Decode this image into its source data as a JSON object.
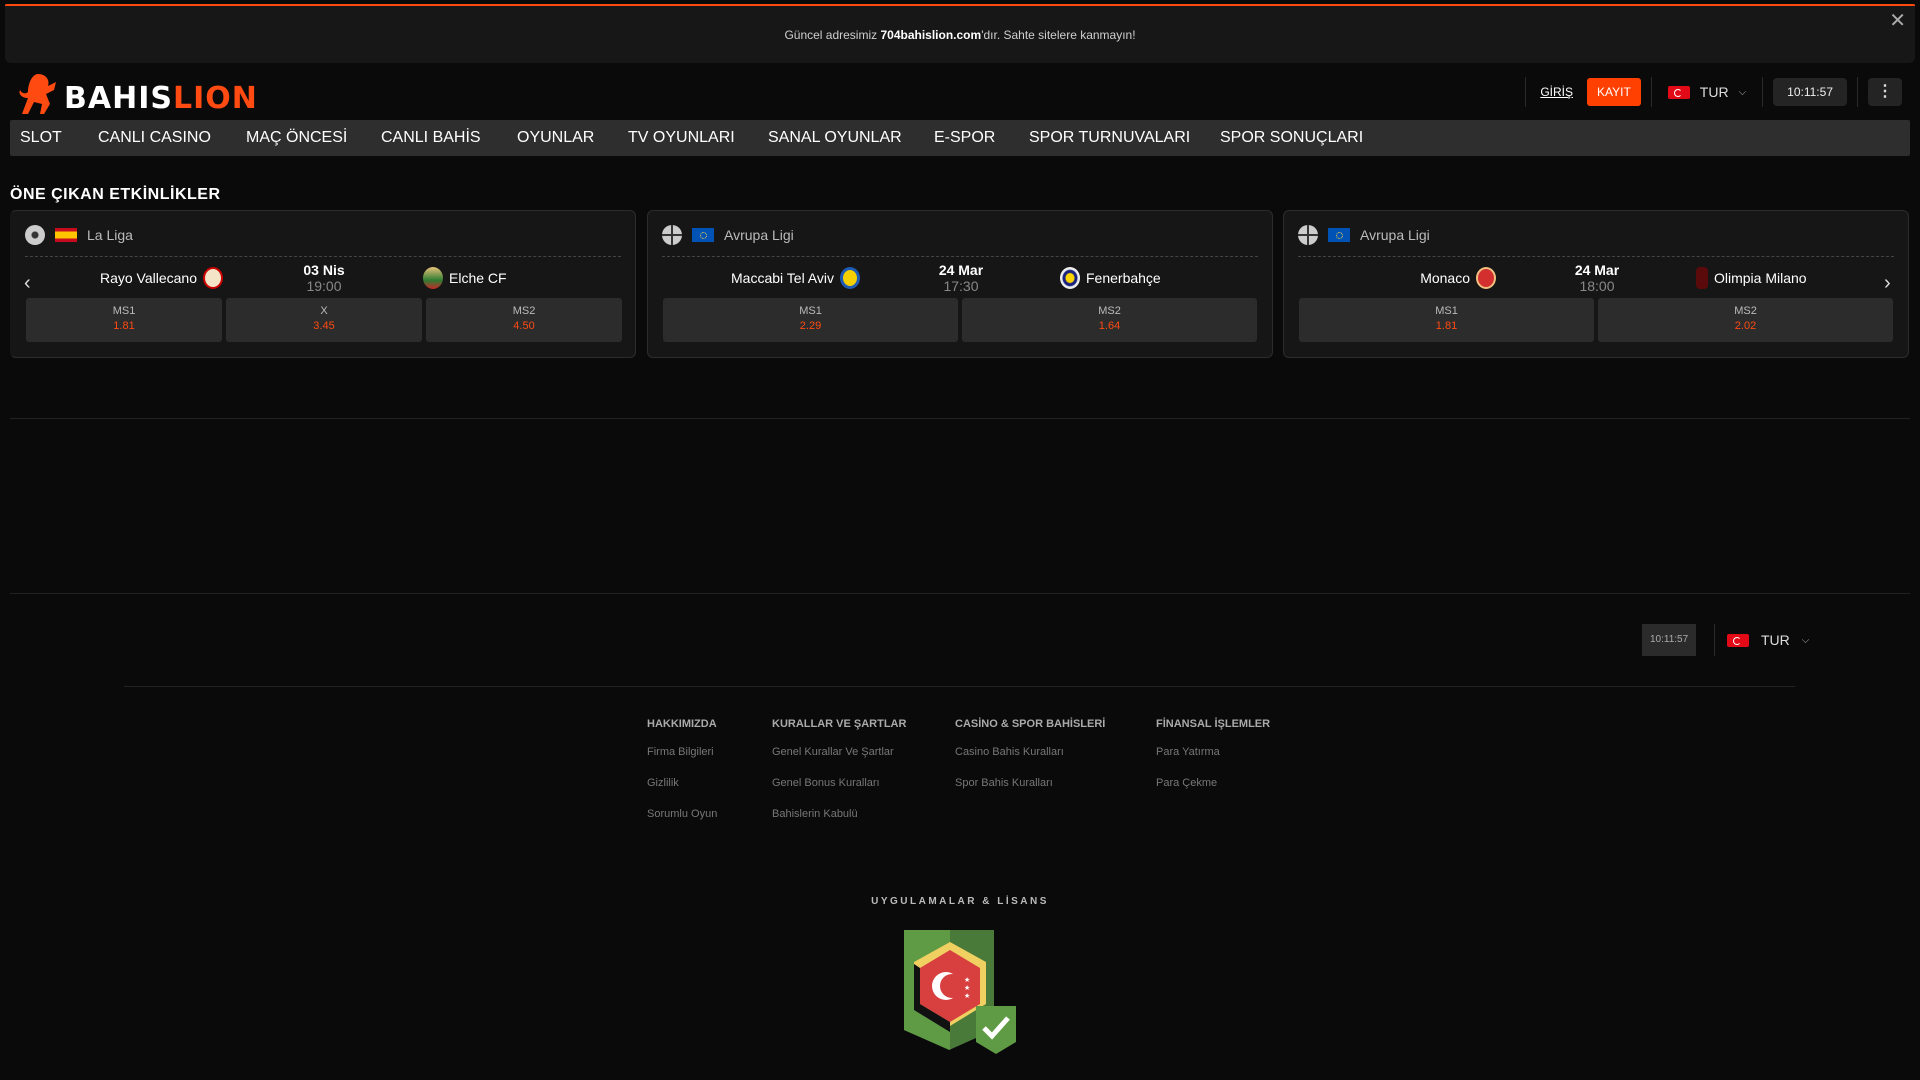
{
  "banner": {
    "prefix": "Güncel adresimiz ",
    "domain": "704bahislion.com",
    "suffix": "'dır. Sahte sitelere kanmayın!"
  },
  "logo": {
    "part1": "BAHIS",
    "part2": "LION"
  },
  "header": {
    "login": "GİRİŞ",
    "register": "KAYIT",
    "lang": "TUR",
    "clock": "10:11:57"
  },
  "nav": [
    "SLOT",
    "CANLI CASINO",
    "MAÇ ÖNCESİ",
    "CANLI BAHİS",
    "OYUNLAR",
    "TV OYUNLARI",
    "SANAL OYUNLAR",
    "E-SPOR",
    "SPOR TURNUVALARI",
    "SPOR SONUÇLARI"
  ],
  "featured": {
    "title": "ÖNE ÇIKAN ETKİNLİKLER",
    "events": [
      {
        "league": "La Liga",
        "home": "Rayo Vallecano",
        "away": "Elche CF",
        "date": "03 Nis",
        "time": "19:00",
        "odds": [
          {
            "label": "MS1",
            "value": "1.81"
          },
          {
            "label": "X",
            "value": "3.45"
          },
          {
            "label": "MS2",
            "value": "4.50"
          }
        ]
      },
      {
        "league": "Avrupa Ligi",
        "home": "Maccabi Tel Aviv",
        "away": "Fenerbahçe",
        "date": "24 Mar",
        "time": "17:30",
        "odds": [
          {
            "label": "MS1",
            "value": "2.29"
          },
          {
            "label": "MS2",
            "value": "1.64"
          }
        ]
      },
      {
        "league": "Avrupa Ligi",
        "home": "Monaco",
        "away": "Olimpia Milano",
        "date": "24 Mar",
        "time": "18:00",
        "odds": [
          {
            "label": "MS1",
            "value": "1.81"
          },
          {
            "label": "MS2",
            "value": "2.02"
          }
        ]
      }
    ]
  },
  "footer": {
    "clock": "10:11:57",
    "lang": "TUR",
    "columns": [
      {
        "title": "HAKKIMIZDA",
        "links": [
          "Firma Bilgileri",
          "Gizlilik",
          "Sorumlu Oyun"
        ]
      },
      {
        "title": "KURALLAR VE ŞARTLAR",
        "links": [
          "Genel Kurallar Ve Şartlar",
          "Genel Bonus Kuralları",
          "Bahislerin Kabulü"
        ]
      },
      {
        "title": "CASİNO & SPOR BAHİSLERİ",
        "links": [
          "Casino Bahis Kuralları",
          "Spor Bahis Kuralları"
        ]
      },
      {
        "title": "FİNANSAL İŞLEMLER",
        "links": [
          "Para Yatırma",
          "Para Çekme"
        ]
      }
    ],
    "license_title": "UYGULAMALAR & LİSANS"
  },
  "colors": {
    "accent": "#ff4a12",
    "bg": "#0a0a0a",
    "card": "#161616"
  }
}
